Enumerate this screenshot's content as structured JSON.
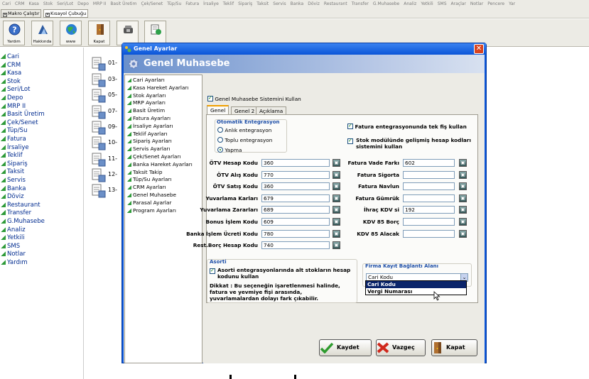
{
  "menubar": [
    "Cari",
    "CRM",
    "Kasa",
    "Stok",
    "Seri/Lot",
    "Depo",
    "MRP II",
    "Basit Üretim",
    "Çek/Senet",
    "Tüp/Su",
    "Fatura",
    "İrsaliye",
    "Teklif",
    "Sipariş",
    "Taksit",
    "Servis",
    "Banka",
    "Döviz",
    "Restaurant",
    "Transfer",
    "G.Muhasebe",
    "Analiz",
    "Yetkili",
    "SMS",
    "Araçlar",
    "Notlar",
    "Pencere",
    "Yar"
  ],
  "toolbar_tabs": [
    {
      "label": "Makro Çalıştır",
      "checked": true
    },
    {
      "label": "Kısayol Çubuğu",
      "checked": true
    }
  ],
  "icon_buttons": [
    {
      "label": "Yardım",
      "icon": "help-icon"
    },
    {
      "label": "Hakkında",
      "icon": "about-logo-icon"
    },
    {
      "label": "www",
      "icon": "globe-icon"
    },
    {
      "label": "Kapat",
      "icon": "exit-door-icon"
    },
    {
      "label": "",
      "icon": "phone-icon"
    },
    {
      "label": "",
      "icon": "document-refresh-icon"
    }
  ],
  "left_panel": [
    "Cari",
    "CRM",
    "Kasa",
    "Stok",
    "Seri/Lot",
    "Depo",
    "MRP II",
    "Basit Üretim",
    "Çek/Senet",
    "Tüp/Su",
    "Fatura",
    "İrsaliye",
    "Teklif",
    "Sipariş",
    "Taksit",
    "Servis",
    "Banka",
    "Döviz",
    "Restaurant",
    "Transfer",
    "G.Muhasebe",
    "Analiz",
    "Yetkili",
    "SMS",
    "Notlar",
    "Yardım"
  ],
  "module_numbers": [
    "01-",
    "03-",
    "05-",
    "07-",
    "09-",
    "10-",
    "11-",
    "12-",
    "13-"
  ],
  "dialog": {
    "window_title": "Genel Ayarlar",
    "close_glyph": "✕",
    "banner_title": "Genel Muhasebe",
    "settings_tree": [
      "Cari Ayarları",
      "Kasa Hareket Ayarları",
      "Stok Ayarları",
      "MRP Ayarları",
      "Basit Üretim",
      "Fatura Ayarları",
      "İrsaliye Ayarları",
      "Teklif Ayarları",
      "Sipariş Ayarları",
      "Servis Ayarları",
      "Çek/Senet Ayarları",
      "Banka Hareket Ayarları",
      "Taksit Takip",
      "Tüp/Su Ayarları",
      "CRM Ayarları",
      "Genel Muhasebe",
      "Parasal Ayarlar",
      "Program Ayarları"
    ],
    "use_system_label": "Genel Muhasebe Sistemini Kullan",
    "use_system_checked": true,
    "tabs": [
      "Genel",
      "Genel 2",
      "Açıklama"
    ],
    "active_tab": "Genel",
    "auto_integration": {
      "title": "Otomatik Entegrasyon",
      "options": [
        "Anlık entegrasyon",
        "Toplu entegrasyon",
        "Yapma"
      ],
      "selected": "Yapma"
    },
    "checkboxes_right": [
      {
        "label": "Fatura entegrasyonunda tek fiş kullan",
        "checked": true
      },
      {
        "label": "Stok modülünde gelişmiş hesap kodları sistemini kullan",
        "checked": true
      }
    ],
    "left_fields": [
      {
        "label": "ÖTV Hesap Kodu",
        "value": "360"
      },
      {
        "label": "ÖTV Alış Kodu",
        "value": "770"
      },
      {
        "label": "ÖTV Satış Kodu",
        "value": "360"
      },
      {
        "label": "Yuvarlama Karları",
        "value": "679"
      },
      {
        "label": "Yuvarlama Zararları",
        "value": "689"
      },
      {
        "label": "Bonus İşlem Kodu",
        "value": "609"
      },
      {
        "label": "Banka İşlem Ücreti Kodu",
        "value": "780"
      },
      {
        "label": "Rest.Borç Hesap Kodu",
        "value": "740"
      }
    ],
    "right_fields": [
      {
        "label": "Fatura Vade Farkı",
        "value": "602"
      },
      {
        "label": "Fatura Sigorta",
        "value": ""
      },
      {
        "label": "Fatura Navlun",
        "value": ""
      },
      {
        "label": "Fatura Gümrük",
        "value": ""
      },
      {
        "label": "İhraç KDV si",
        "value": "192"
      },
      {
        "label": "KDV 85 Borç",
        "value": ""
      },
      {
        "label": "KDV 85 Alacak",
        "value": ""
      }
    ],
    "asorti": {
      "title": "Asorti",
      "checkbox_label": "Asorti entegrasyonlarında alt stokların hesap kodunu kullan",
      "checked": true,
      "note": "Dikkat : Bu seçeneğin işaretlenmesi halinde, fatura ve yevmiye fişi arasında, yuvarlamalardan dolayı fark çıkabilir."
    },
    "firma_kayit": {
      "title": "Firma Kayıt Bağlantı Alanı",
      "selected": "Cari Kodu",
      "options": [
        "Cari Kodu",
        "Vergi Numarası"
      ],
      "highlighted": "Cari Kodu"
    },
    "buttons": {
      "save": "Kaydet",
      "cancel": "Vazgeç",
      "close": "Kapat"
    }
  },
  "colors": {
    "dialog_titlebar": "#0a55d8",
    "group_title": "#1e4fa8",
    "nav_text": "#002b8f",
    "dropdown_highlight": "#0a246a"
  }
}
